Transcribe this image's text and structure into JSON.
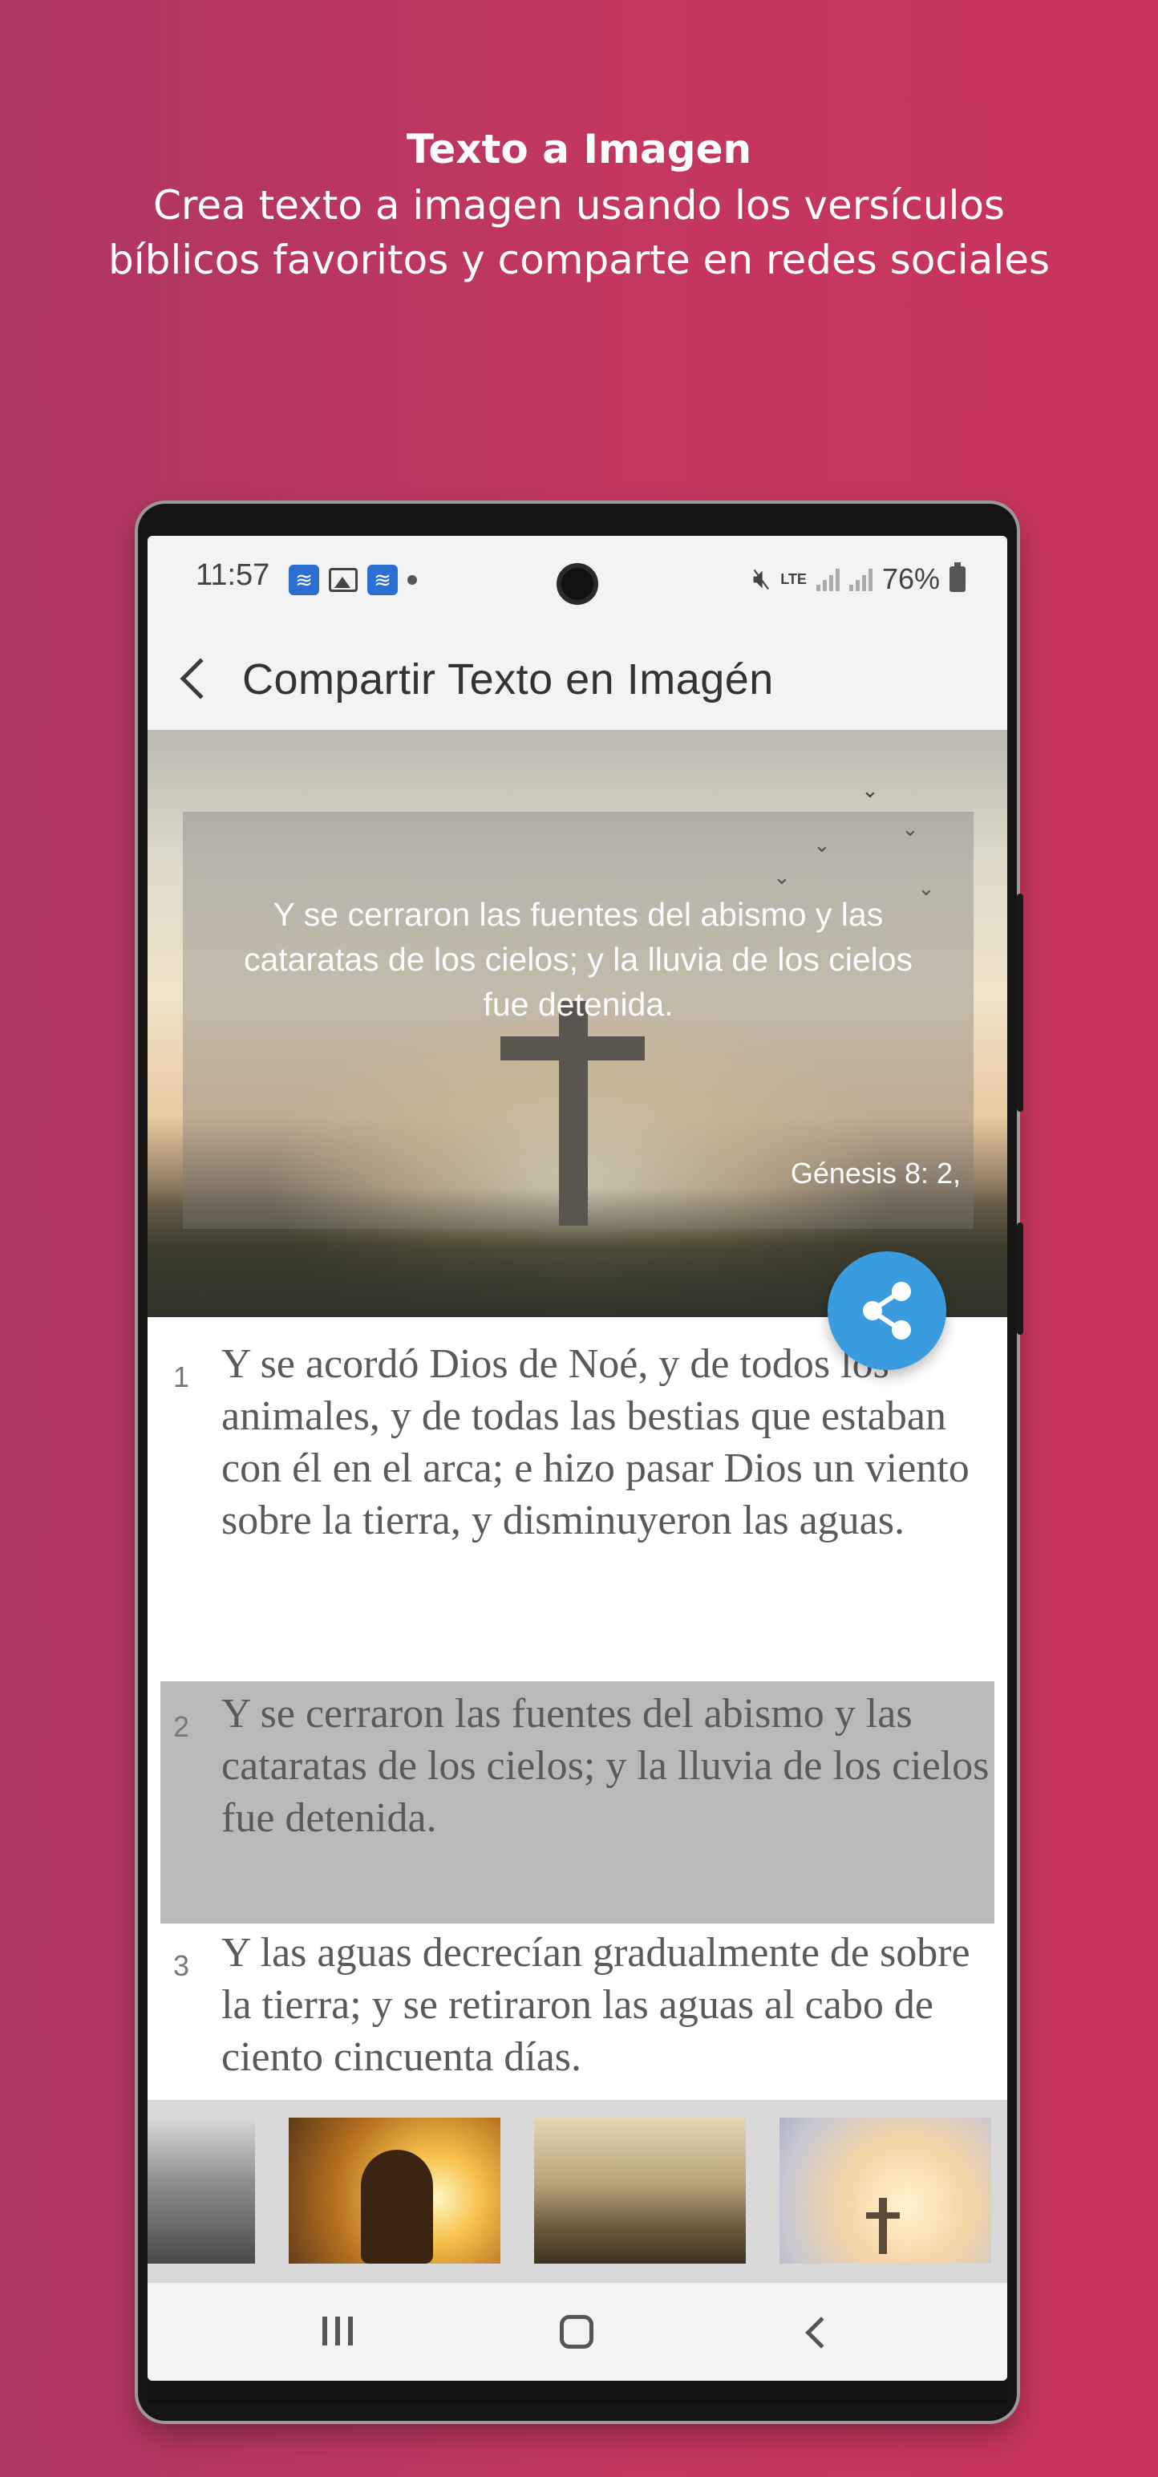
{
  "promo": {
    "title": "Texto a Imagen",
    "subtitle_line1": "Crea texto a imagen usando los versículos",
    "subtitle_line2": "bíblicos favoritos y comparte en redes sociales"
  },
  "status_bar": {
    "time": "11:57",
    "network": "LTE",
    "battery": "76%"
  },
  "app_bar": {
    "title": "Compartir Texto en Imagén"
  },
  "image_preview": {
    "verse": "Y se cerraron las fuentes del abismo y las cataratas de los cielos; y la lluvia de los cielos fue detenida.",
    "reference": "Génesis 8: 2,"
  },
  "verses": [
    {
      "number": "1",
      "text": "Y se acordó Dios de Noé, y de todos los animales, y de todas las bestias que estaban con él en el arca; e hizo pasar Dios un viento sobre la tierra, y disminuyeron las aguas.",
      "selected": false
    },
    {
      "number": "2",
      "text": "Y se cerraron las fuentes del abismo y las cataratas de los cielos; y la lluvia de los cielos fue detenida.",
      "selected": true
    },
    {
      "number": "3",
      "text": "Y las aguas decrecían gradualmente de sobre la tierra; y se retiraron las aguas al cabo de ciento cincuenta días.",
      "selected": false
    }
  ],
  "backgrounds": [
    "stormy-clouds",
    "golden-sunset-woman",
    "mountain-valley-hiker",
    "sky-cross-birds"
  ],
  "colors": {
    "page_background": "#c4375f",
    "fab": "#3a9bde",
    "selected_row": "#b9b9b9"
  }
}
